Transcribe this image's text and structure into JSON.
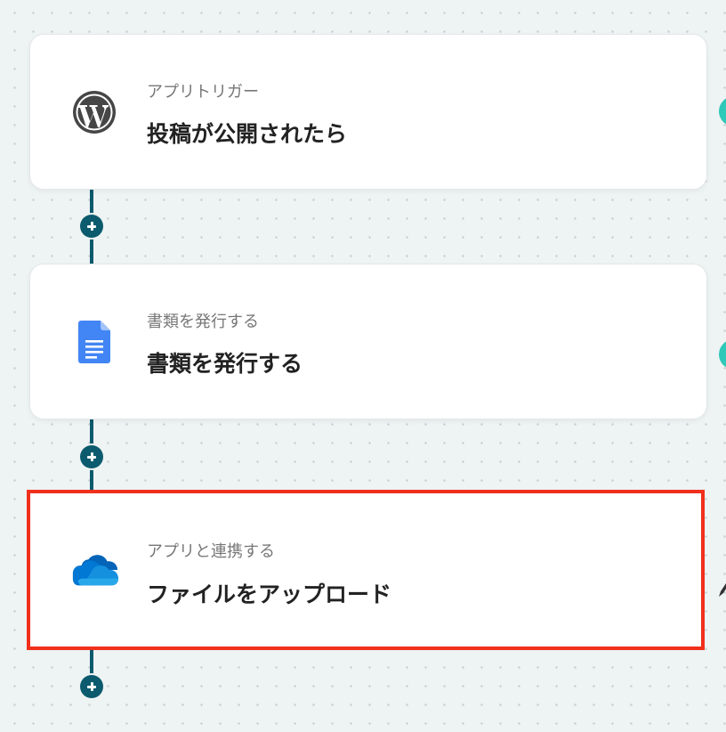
{
  "flow": {
    "steps": [
      {
        "subtitle": "アプリトリガー",
        "title": "投稿が公開されたら",
        "icon": "wordpress-icon",
        "highlighted": false
      },
      {
        "subtitle": "書類を発行する",
        "title": "書類を発行する",
        "icon": "google-docs-icon",
        "highlighted": false
      },
      {
        "subtitle": "アプリと連携する",
        "title": "ファイルをアップロード",
        "icon": "onedrive-icon",
        "highlighted": true
      }
    ],
    "add_step_icon": "plus-icon"
  },
  "colors": {
    "background": "#eef3f3",
    "connector": "#0c5a6e",
    "highlight_border": "#f0301c",
    "side_badge": "#2ec9b8",
    "docs_blue": "#4285f4",
    "onedrive_dark": "#0364b8",
    "onedrive_light": "#28a8ea"
  }
}
